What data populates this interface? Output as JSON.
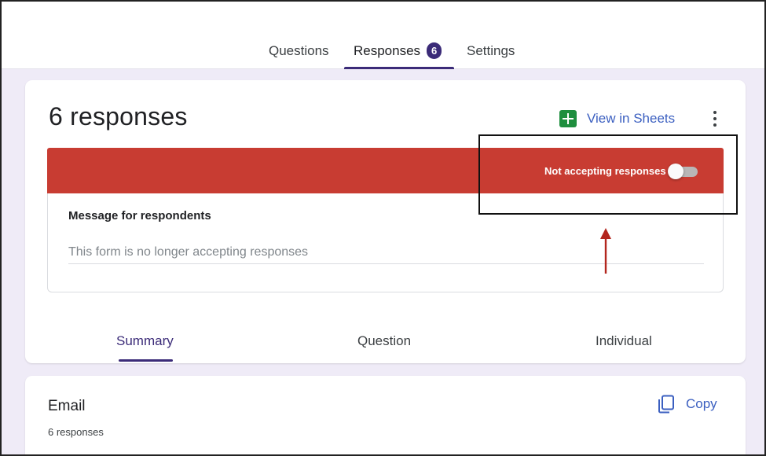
{
  "header": {
    "tabs": [
      {
        "label": "Questions"
      },
      {
        "label": "Responses",
        "badge": "6"
      },
      {
        "label": "Settings"
      }
    ]
  },
  "responses_card": {
    "title": "6 responses",
    "view_in_sheets_label": "View in Sheets",
    "more_icon": "more-vert-icon",
    "sheets_icon": "google-sheets-icon",
    "banner": {
      "label": "Not accepting responses",
      "color": "#c83c32",
      "toggle_on": false
    },
    "message": {
      "title": "Message for respondents",
      "value": "This form is no longer accepting responses"
    },
    "subtabs": [
      {
        "label": "Summary"
      },
      {
        "label": "Question"
      },
      {
        "label": "Individual"
      }
    ]
  },
  "email_card": {
    "title": "Email",
    "count": "6 responses",
    "copy_label": "Copy",
    "copy_icon": "copy-icon"
  },
  "colors": {
    "accent": "#3b2b78",
    "link": "#3b5fc0",
    "background": "#efebf7",
    "annotation_arrow": "#b3261e"
  }
}
